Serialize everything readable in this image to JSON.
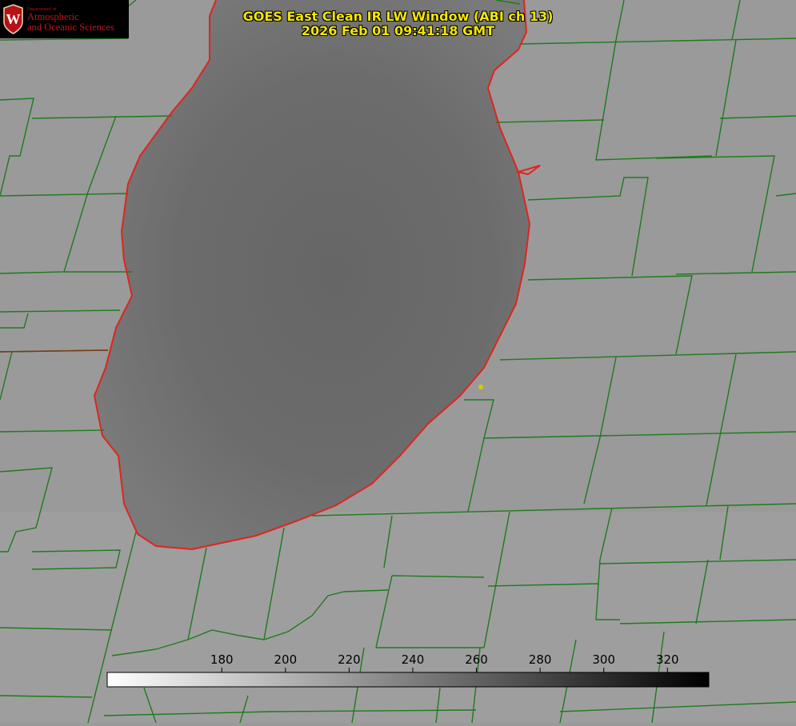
{
  "header": {
    "title_line1": "GOES East Clean IR LW Window (ABI ch 13)",
    "title_line2": "2026 Feb 01 09:41:18 GMT"
  },
  "logo": {
    "department": "Department of",
    "line1": "Atmospheric",
    "line2": "and Oceanic Sciences",
    "seal_letter": "W",
    "seal_color": "#b51218"
  },
  "colorbar": {
    "ticks": [
      180,
      200,
      220,
      240,
      260,
      280,
      300,
      320
    ],
    "range": [
      144,
      333
    ],
    "gradient_from": "#ffffff",
    "gradient_to": "#000000"
  },
  "map_colors": {
    "land": "#9a9a9a",
    "lake": "#6f6f6f",
    "county_lines": "#1f7a1f",
    "coastline": "#e0241c",
    "marker": "#d8c800"
  }
}
